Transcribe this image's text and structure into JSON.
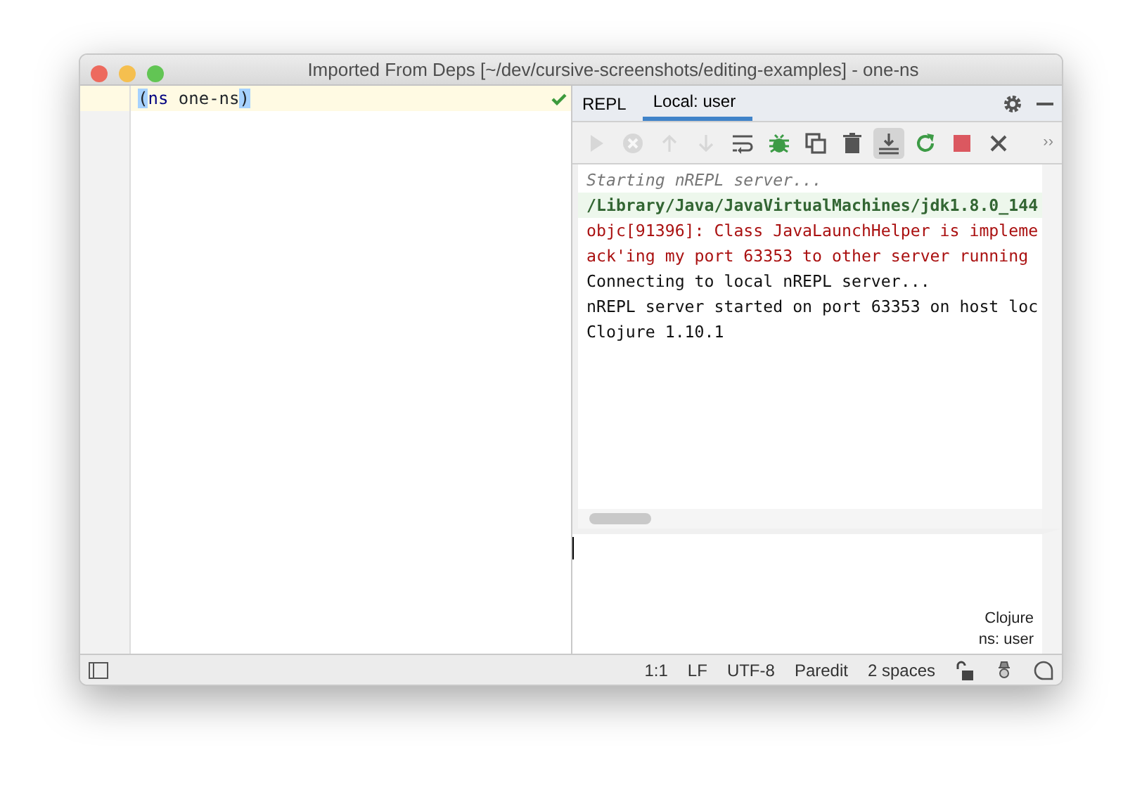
{
  "window": {
    "title": "Imported From Deps [~/dev/cursive-screenshots/editing-examples] - one-ns"
  },
  "editor": {
    "lines": [
      {
        "text": "(ns one-ns)",
        "current": true,
        "ok": true
      }
    ]
  },
  "repl": {
    "tabs": [
      {
        "label": "REPL",
        "selected": false
      },
      {
        "label": "Local: user",
        "selected": true
      }
    ],
    "toolbar": [
      {
        "kind": "run",
        "disabled": true,
        "selected": false
      },
      {
        "kind": "cancel",
        "disabled": true,
        "selected": false
      },
      {
        "kind": "up",
        "disabled": true,
        "selected": false
      },
      {
        "kind": "down",
        "disabled": true,
        "selected": false
      },
      {
        "kind": "wrap",
        "disabled": false,
        "selected": false
      },
      {
        "kind": "debug",
        "disabled": false,
        "selected": false
      },
      {
        "kind": "copy",
        "disabled": false,
        "selected": false
      },
      {
        "kind": "trash",
        "disabled": false,
        "selected": false
      },
      {
        "kind": "scroll",
        "disabled": false,
        "selected": true
      },
      {
        "kind": "rerun",
        "disabled": false,
        "selected": false
      },
      {
        "kind": "stop",
        "disabled": false,
        "selected": false
      },
      {
        "kind": "close",
        "disabled": false,
        "selected": false
      }
    ],
    "more": "››",
    "output": [
      {
        "kind": "info",
        "text": "Starting nREPL server..."
      },
      {
        "kind": "command",
        "text": "/Library/Java/JavaVirtualMachines/jdk1.8.0_144"
      },
      {
        "kind": "error",
        "text": "objc[91396]: Class JavaLaunchHelper is impleme"
      },
      {
        "kind": "error",
        "text": "ack'ing my port 63353 to other server running"
      },
      {
        "kind": "plain",
        "text": "Connecting to local nREPL server..."
      },
      {
        "kind": "plain",
        "text": "nREPL server started on port 63353 on host loc"
      },
      {
        "kind": "plain",
        "text": "Clojure 1.10.1"
      }
    ],
    "input_info": [
      "Clojure",
      "ns: user"
    ]
  },
  "status_bar": {
    "items": [
      "1:1",
      "LF",
      "UTF-8",
      "Paredit",
      "2 spaces"
    ]
  }
}
